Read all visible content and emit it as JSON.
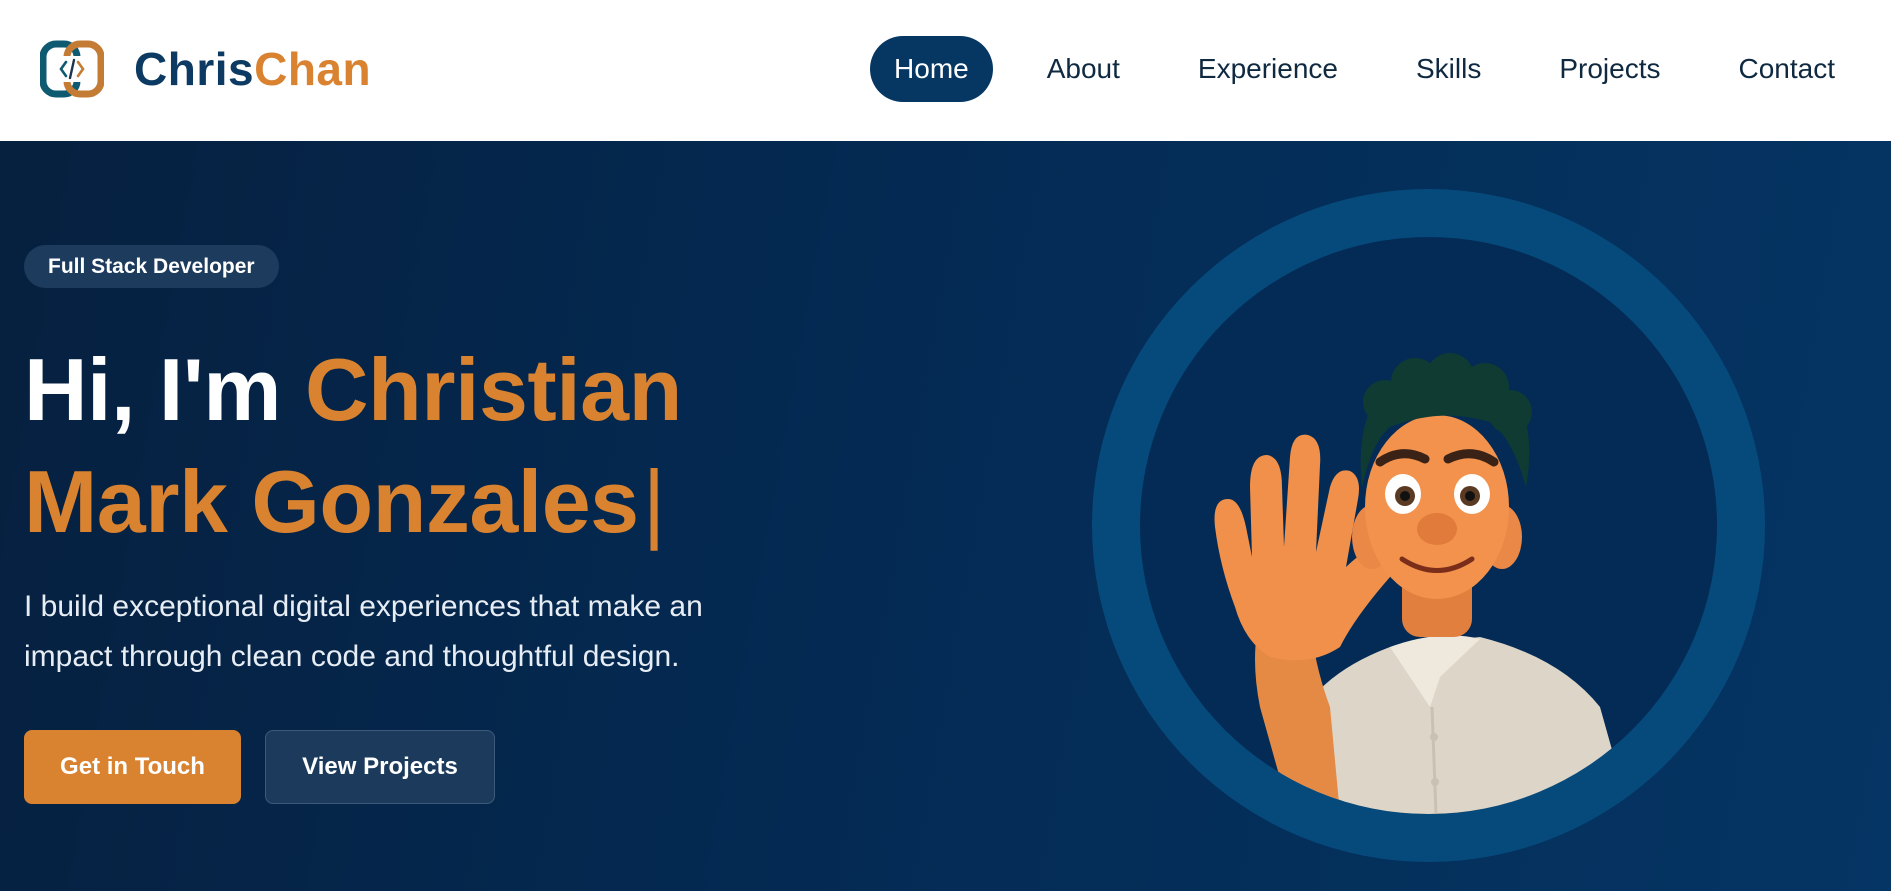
{
  "brand": {
    "first": "Chris",
    "second": "Chan",
    "logo_icon": "code-brackets-icon"
  },
  "nav": {
    "items": [
      {
        "label": "Home",
        "active": true
      },
      {
        "label": "About",
        "active": false
      },
      {
        "label": "Experience",
        "active": false
      },
      {
        "label": "Skills",
        "active": false
      },
      {
        "label": "Projects",
        "active": false
      },
      {
        "label": "Contact",
        "active": false
      }
    ]
  },
  "hero": {
    "badge": "Full Stack Developer",
    "greeting": "Hi, I'm ",
    "name_line1": "Christian",
    "name_line2": "Mark Gonzales",
    "cursor": "|",
    "tagline": "I build exceptional digital experiences that make an impact through clean code and thoughtful design.",
    "primary_button": "Get in Touch",
    "secondary_button": "View Projects",
    "avatar": "waving-cartoon-avatar"
  },
  "colors": {
    "navy": "#063763",
    "accent": "#d9822f",
    "hero_bg": "#042a53",
    "ring": "#064a7c"
  }
}
